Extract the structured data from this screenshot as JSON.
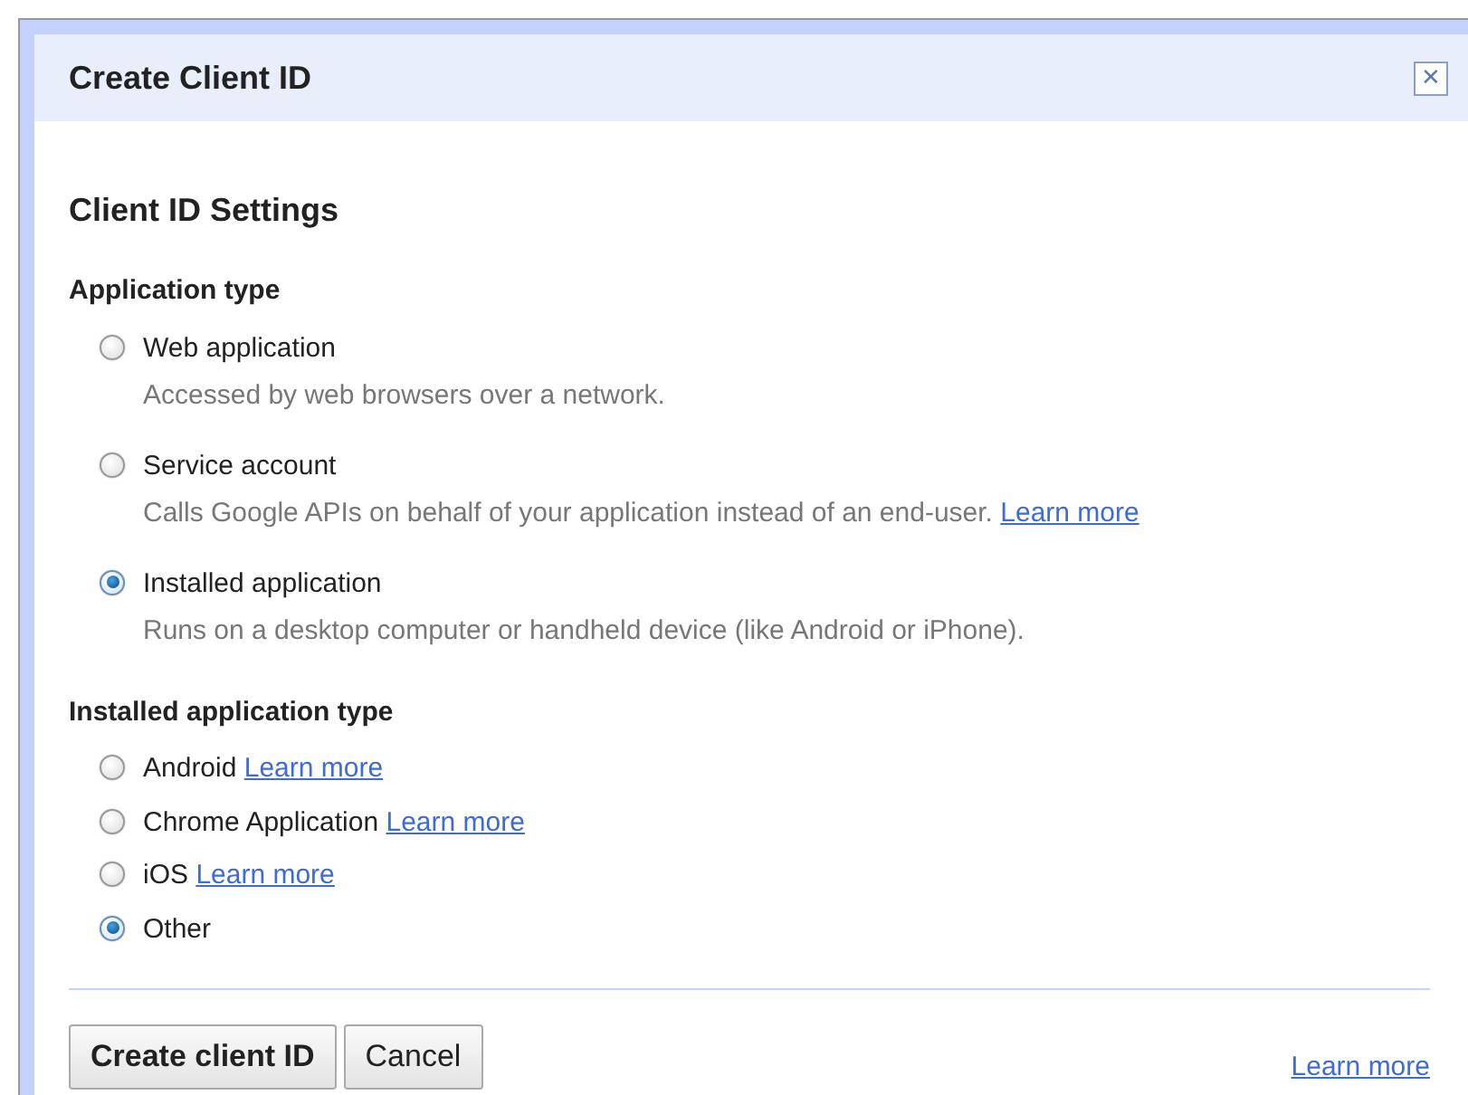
{
  "dialog": {
    "title": "Create Client ID",
    "close": "✕"
  },
  "settings_heading": "Client ID Settings",
  "application_type": {
    "label": "Application type",
    "options": [
      {
        "label": "Web application",
        "description": "Accessed by web browsers over a network.",
        "selected": false
      },
      {
        "label": "Service account",
        "description": "Calls Google APIs on behalf of your application instead of an end-user.",
        "link": "Learn more",
        "selected": false
      },
      {
        "label": "Installed application",
        "description": "Runs on a desktop computer or handheld device (like Android or iPhone).",
        "selected": true
      }
    ]
  },
  "installed_application_type": {
    "label": "Installed application type",
    "options": [
      {
        "label": "Android",
        "link": "Learn more",
        "selected": false
      },
      {
        "label": "Chrome Application",
        "link": "Learn more",
        "selected": false
      },
      {
        "label": "iOS",
        "link": "Learn more",
        "selected": false
      },
      {
        "label": "Other",
        "selected": true
      }
    ]
  },
  "buttons": [
    {
      "label": "Create client ID",
      "kind": "primary"
    },
    {
      "label": "Cancel",
      "kind": "secondary"
    }
  ],
  "footer_link": "Learn more"
}
